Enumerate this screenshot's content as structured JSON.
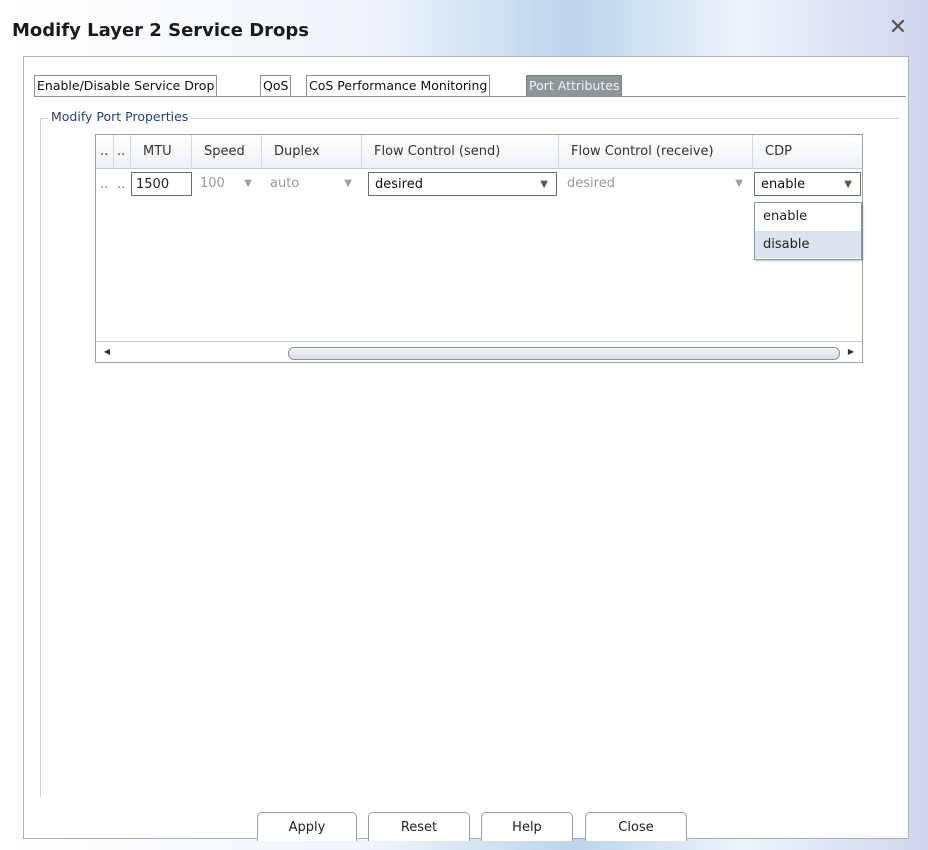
{
  "window": {
    "title": "Modify Layer 2 Service Drops",
    "close_icon": "✕"
  },
  "tabs": [
    {
      "label": "Enable/Disable Service Drop",
      "active": false
    },
    {
      "label": "QoS",
      "active": false
    },
    {
      "label": "CoS Performance Monitoring",
      "active": false
    },
    {
      "label": "Port Attributes",
      "active": true
    }
  ],
  "group": {
    "label": "Modify Port Properties"
  },
  "table": {
    "columns": [
      "..",
      "..",
      "MTU",
      "Speed",
      "Duplex",
      "Flow Control (send)",
      "Flow Control (receive)",
      "CDP"
    ],
    "row": {
      "col0": "..",
      "col1": "..",
      "mtu": "1500",
      "speed": "100",
      "duplex": "auto",
      "flow_send": "desired",
      "flow_receive": "desired",
      "cdp": "enable"
    },
    "cdp_options": [
      "enable",
      "disable"
    ]
  },
  "buttons": {
    "apply": "Apply",
    "reset": "Reset",
    "help": "Help",
    "close": "Close"
  }
}
